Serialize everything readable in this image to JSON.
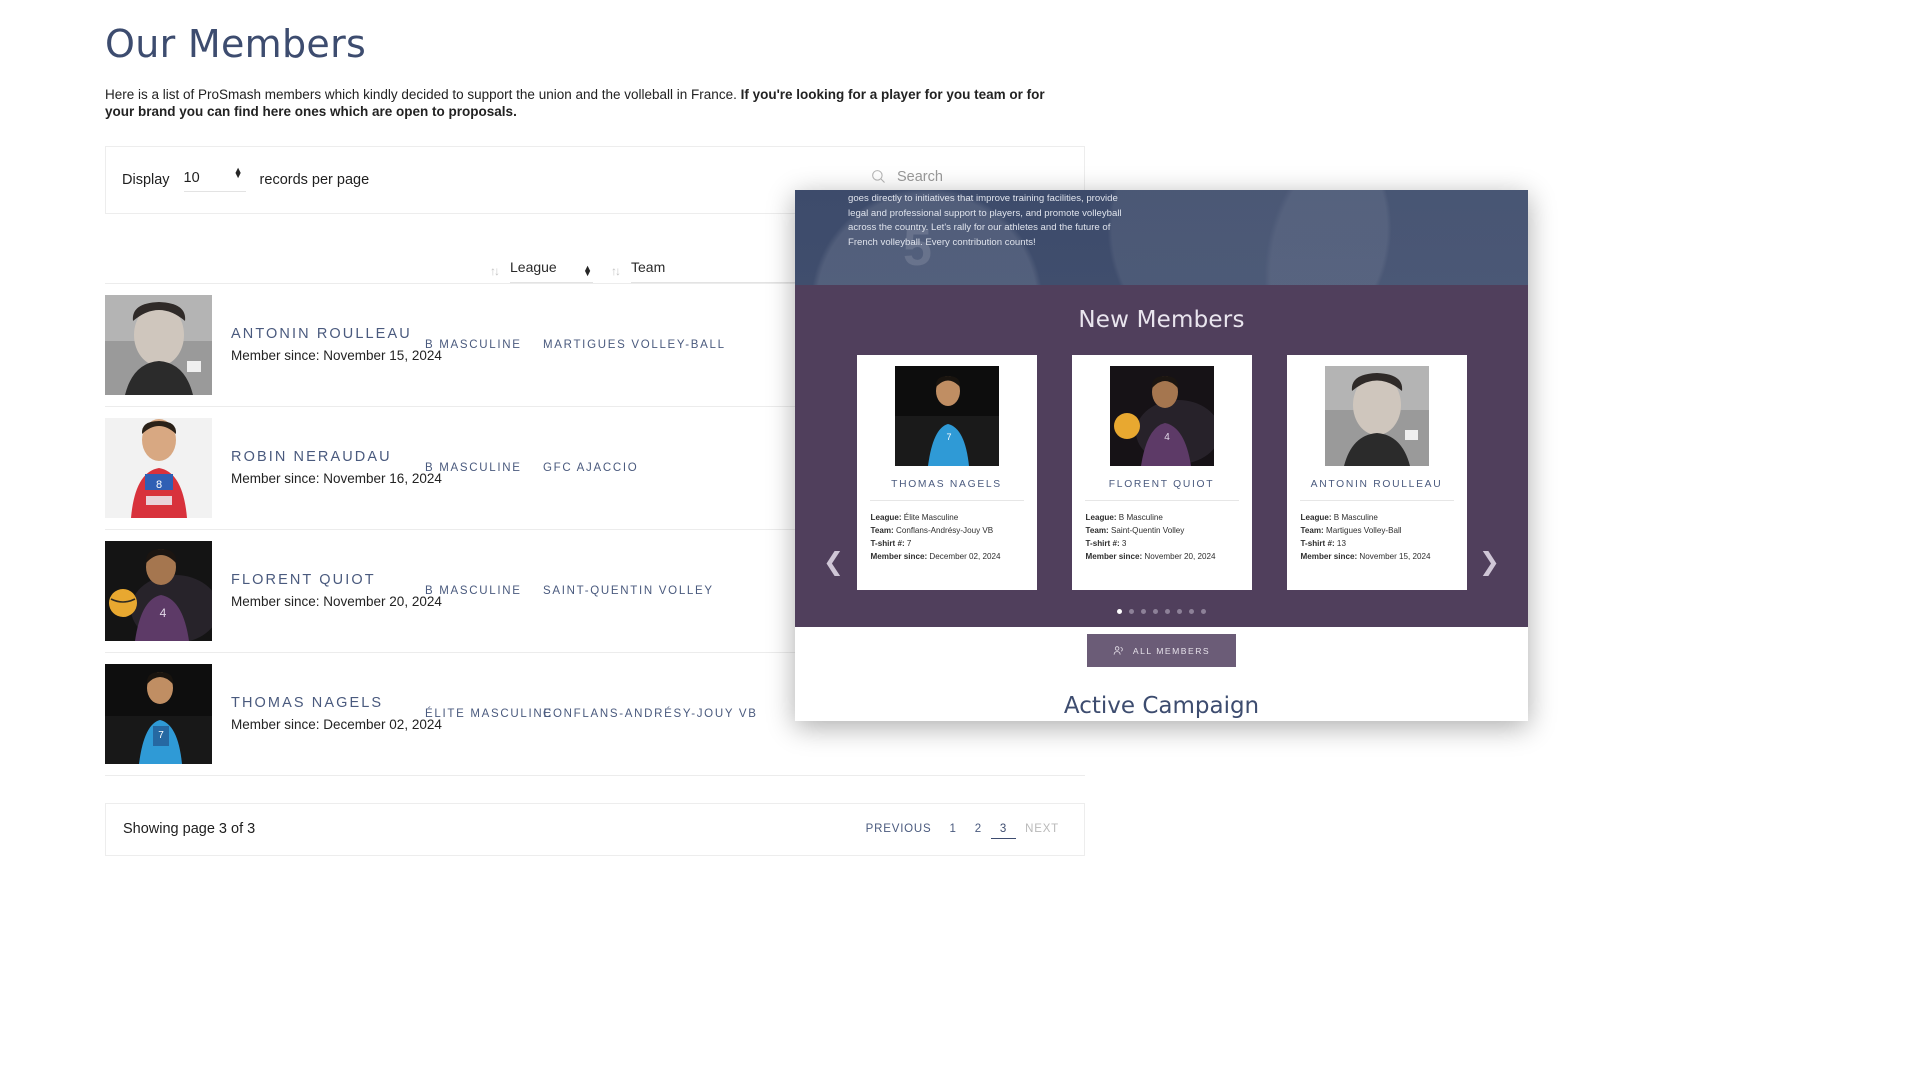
{
  "page": {
    "title": "Our Members",
    "intro_plain": "Here is a list of ProSmash members which kindly decided to support the union and the volleball in France. ",
    "intro_bold": "If you're looking for a player for you team or for your brand you can find here ones which are open to proposals."
  },
  "controls": {
    "display_label": "Display",
    "records_value": "10",
    "records_suffix": "records per page",
    "search_placeholder": "Search",
    "search_value": "",
    "search_icon": "search-icon",
    "spinner_icon": "updown-spinner-icon"
  },
  "filters": {
    "sort_icon": "sort-updown-icon",
    "league": {
      "label": "League",
      "options": [
        "League",
        "Élite Masculine",
        "B Masculine"
      ]
    },
    "team": {
      "label": "Team",
      "options": [
        "Team",
        "Martigues Volley-Ball",
        "GFC Ajaccio",
        "Saint-Quentin Volley",
        "Conflans-Andrésy-Jouy VB"
      ]
    }
  },
  "members": [
    {
      "name": "ANTONIN ROULLEAU",
      "since": "Member since: November 15, 2024",
      "league": "B MASCULINE",
      "team": "MARTIGUES VOLLEY-BALL",
      "photo": "portrait-bw"
    },
    {
      "name": "ROBIN NERAUDAU",
      "since": "Member since: November 16, 2024",
      "league": "B MASCULINE",
      "team": "GFC AJACCIO",
      "photo": "portrait-red-jersey"
    },
    {
      "name": "FLORENT QUIOT",
      "since": "Member since: November 20, 2024",
      "league": "B MASCULINE",
      "team": "SAINT-QUENTIN VOLLEY",
      "photo": "portrait-purple-ball"
    },
    {
      "name": "THOMAS NAGELS",
      "since": "Member since: December 02, 2024",
      "league": "ÉLITE MASCULINE",
      "team": "CONFLANS-ANDRÉSY-JOUY VB",
      "photo": "portrait-blue-jersey"
    }
  ],
  "pagination": {
    "showing": "Showing page 3 of 3",
    "previous": "PREVIOUS",
    "next": "NEXT",
    "pages": [
      "1",
      "2",
      "3"
    ],
    "active_page": "3"
  },
  "overlay": {
    "hero_text": "goes directly to initiatives that improve training facilities, provide legal and professional support to players, and promote volleyball across the country. Let's rally for our athletes and the future of French volleyball. Every contribution counts!",
    "hero_number": "5",
    "section_title": "New Members",
    "prev_arrow_icon": "chevron-left-icon",
    "next_arrow_icon": "chevron-right-icon",
    "cards": [
      {
        "name": "THOMAS NAGELS",
        "league_label": "League:",
        "league_value": " Élite Masculine",
        "team_label": "Team:",
        "team_value": " Conflans-Andrésy-Jouy VB",
        "tshirt_label": "T-shirt #:",
        "tshirt_value": " 7",
        "since_label": "Member since:",
        "since_value": " December 02, 2024",
        "photo": "portrait-blue-jersey"
      },
      {
        "name": "FLORENT QUIOT",
        "league_label": "League:",
        "league_value": " B Masculine",
        "team_label": "Team:",
        "team_value": " Saint-Quentin Volley",
        "tshirt_label": "T-shirt #:",
        "tshirt_value": " 3",
        "since_label": "Member since:",
        "since_value": " November 20, 2024",
        "photo": "portrait-purple-ball"
      },
      {
        "name": "ANTONIN ROULLEAU",
        "league_label": "League:",
        "league_value": " B Masculine",
        "team_label": "Team:",
        "team_value": " Martigues Volley-Ball",
        "tshirt_label": "T-shirt #:",
        "tshirt_value": " 13",
        "since_label": "Member since:",
        "since_value": " November 15, 2024",
        "photo": "portrait-bw"
      }
    ],
    "dots_count": 8,
    "active_dot": 0,
    "all_members_label": "ALL MEMBERS",
    "all_members_icon": "people-icon",
    "campaign_title": "Active Campaign"
  },
  "colors": {
    "heading": "#3d4c6f",
    "accent_link": "#4a5a7e",
    "overlay_purple": "#503f5c",
    "overlay_hero_blue": "#3e4c6c",
    "button_purple": "#6b5c77"
  }
}
